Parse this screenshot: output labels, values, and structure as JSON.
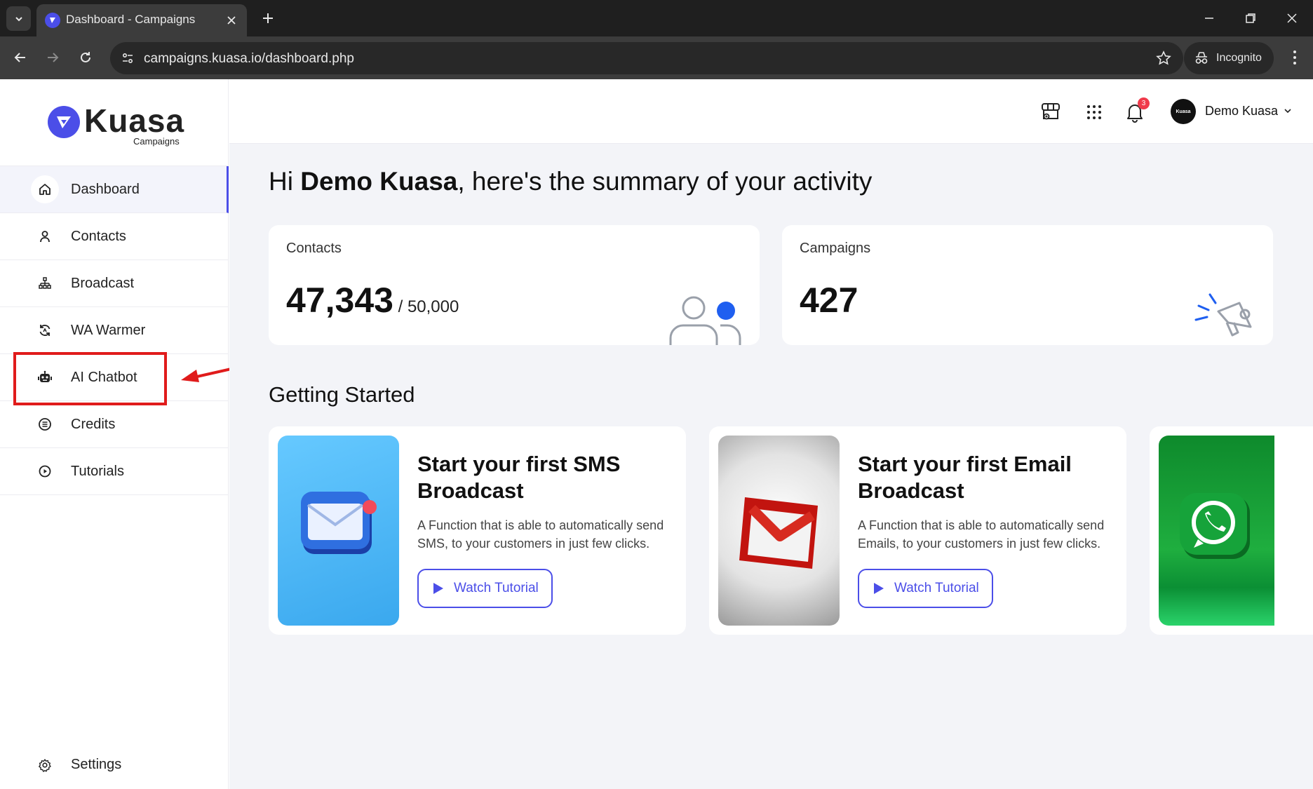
{
  "browser": {
    "tab_title": "Dashboard - Campaigns",
    "url": "campaigns.kuasa.io/dashboard.php",
    "incognito_label": "Incognito"
  },
  "brand": {
    "name": "Kuasa",
    "subtitle": "Campaigns",
    "color": "#4b4ee8"
  },
  "sidebar": {
    "items": [
      {
        "label": "Dashboard",
        "icon": "home-icon",
        "active": true
      },
      {
        "label": "Contacts",
        "icon": "user-icon"
      },
      {
        "label": "Broadcast",
        "icon": "broadcast-icon"
      },
      {
        "label": "WA Warmer",
        "icon": "refresh-chat-icon"
      },
      {
        "label": "AI Chatbot",
        "icon": "robot-icon"
      },
      {
        "label": "Credits",
        "icon": "credits-icon"
      },
      {
        "label": "Tutorials",
        "icon": "play-circle-icon"
      }
    ],
    "settings_label": "Settings"
  },
  "header": {
    "notification_count": "3",
    "user_name": "Demo Kuasa",
    "avatar_text": "Kuasa"
  },
  "main": {
    "greeting_prefix": "Hi ",
    "greeting_name": "Demo Kuasa",
    "greeting_suffix": ", here's the summary of your activity",
    "stats": {
      "contacts_label": "Contacts",
      "contacts_value": "47,343",
      "contacts_max": " / 50,000",
      "campaigns_label": "Campaigns",
      "campaigns_value": "427"
    },
    "getting_started_title": "Getting Started",
    "cards": [
      {
        "title": "Start your first SMS Broadcast",
        "description": "A Function that is able to automatically send SMS, to your customers in just few clicks.",
        "button": "Watch Tutorial"
      },
      {
        "title": "Start your first Email Broadcast",
        "description": "A Function that is able to automatically send Emails, to your customers in just few clicks.",
        "button": "Watch Tutorial"
      }
    ]
  },
  "annotation": {
    "highlight_color": "#e01b1b"
  }
}
